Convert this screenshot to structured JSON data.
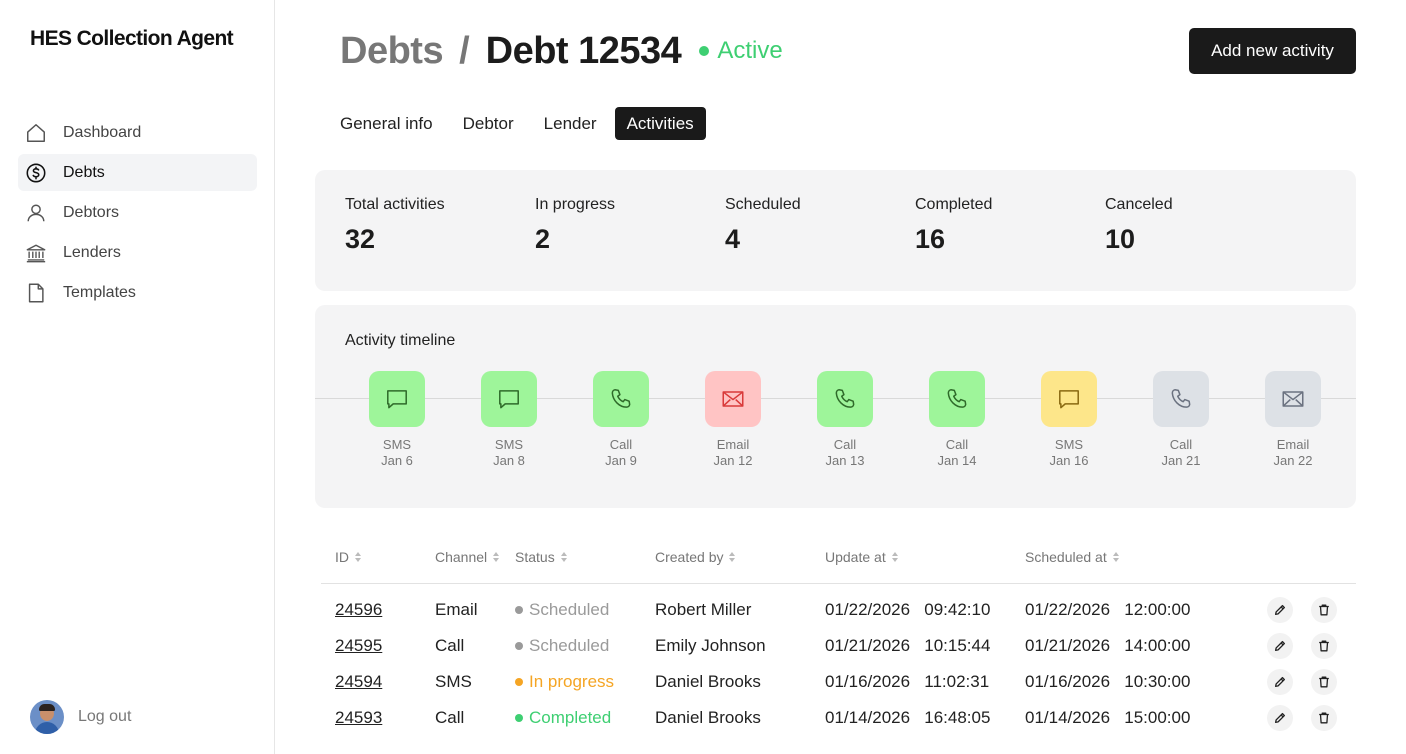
{
  "app": {
    "brand": "HES Collection Agent"
  },
  "sidebar": {
    "items": [
      {
        "label": "Dashboard",
        "icon": "home-icon",
        "active": false
      },
      {
        "label": "Debts",
        "icon": "dollar-circle-icon",
        "active": true
      },
      {
        "label": "Debtors",
        "icon": "user-icon",
        "active": false
      },
      {
        "label": "Lenders",
        "icon": "bank-icon",
        "active": false
      },
      {
        "label": "Templates",
        "icon": "document-icon",
        "active": false
      }
    ],
    "logout_label": "Log out"
  },
  "header": {
    "breadcrumb_parent": "Debts",
    "breadcrumb_separator": "/",
    "title": "Debt 12534",
    "status": "Active",
    "status_color": "#3ecf72",
    "primary_action": "Add new activity"
  },
  "tabs": [
    {
      "label": "General info",
      "active": false
    },
    {
      "label": "Debtor",
      "active": false
    },
    {
      "label": "Lender",
      "active": false
    },
    {
      "label": "Activities",
      "active": true
    }
  ],
  "stats": [
    {
      "label": "Total activities",
      "value": "32"
    },
    {
      "label": "In progress",
      "value": "2"
    },
    {
      "label": "Scheduled",
      "value": "4"
    },
    {
      "label": "Completed",
      "value": "16"
    },
    {
      "label": "Canceled",
      "value": "10"
    }
  ],
  "timeline": {
    "title": "Activity timeline",
    "colors": {
      "green_bg": "#9ef59a",
      "green_fg": "#2f6b2a",
      "red_bg": "#ffc4c4",
      "red_fg": "#d93a3a",
      "yellow_bg": "#fde68a",
      "yellow_fg": "#8a6a12",
      "gray_bg": "#dde1e6",
      "gray_fg": "#6b7280"
    },
    "items": [
      {
        "channel": "SMS",
        "date": "Jan 6",
        "icon": "message-icon",
        "tone": "green"
      },
      {
        "channel": "SMS",
        "date": "Jan 8",
        "icon": "message-icon",
        "tone": "green"
      },
      {
        "channel": "Call",
        "date": "Jan 9",
        "icon": "phone-icon",
        "tone": "green"
      },
      {
        "channel": "Email",
        "date": "Jan 12",
        "icon": "mail-icon",
        "tone": "red"
      },
      {
        "channel": "Call",
        "date": "Jan 13",
        "icon": "phone-icon",
        "tone": "green"
      },
      {
        "channel": "Call",
        "date": "Jan 14",
        "icon": "phone-icon",
        "tone": "green"
      },
      {
        "channel": "SMS",
        "date": "Jan 16",
        "icon": "message-icon",
        "tone": "yellow"
      },
      {
        "channel": "Call",
        "date": "Jan 21",
        "icon": "phone-icon",
        "tone": "gray"
      },
      {
        "channel": "Email",
        "date": "Jan 22",
        "icon": "mail-icon",
        "tone": "gray"
      }
    ]
  },
  "table": {
    "columns": [
      "ID",
      "Channel",
      "Status",
      "Created by",
      "Update at",
      "Scheduled at"
    ],
    "status_colors": {
      "Scheduled": "#9a9a9a",
      "In progress": "#f5a524",
      "Completed": "#3ecf72"
    },
    "rows": [
      {
        "id": "24596",
        "channel": "Email",
        "status": "Scheduled",
        "created_by": "Robert Miller",
        "updated_date": "01/22/2026",
        "updated_time": "09:42:10",
        "scheduled_date": "01/22/2026",
        "scheduled_time": "12:00:00"
      },
      {
        "id": "24595",
        "channel": "Call",
        "status": "Scheduled",
        "created_by": "Emily Johnson",
        "updated_date": "01/21/2026",
        "updated_time": "10:15:44",
        "scheduled_date": "01/21/2026",
        "scheduled_time": "14:00:00"
      },
      {
        "id": "24594",
        "channel": "SMS",
        "status": "In progress",
        "created_by": "Daniel Brooks",
        "updated_date": "01/16/2026",
        "updated_time": "11:02:31",
        "scheduled_date": "01/16/2026",
        "scheduled_time": "10:30:00"
      },
      {
        "id": "24593",
        "channel": "Call",
        "status": "Completed",
        "created_by": "Daniel Brooks",
        "updated_date": "01/14/2026",
        "updated_time": "16:48:05",
        "scheduled_date": "01/14/2026",
        "scheduled_time": "15:00:00"
      }
    ]
  }
}
